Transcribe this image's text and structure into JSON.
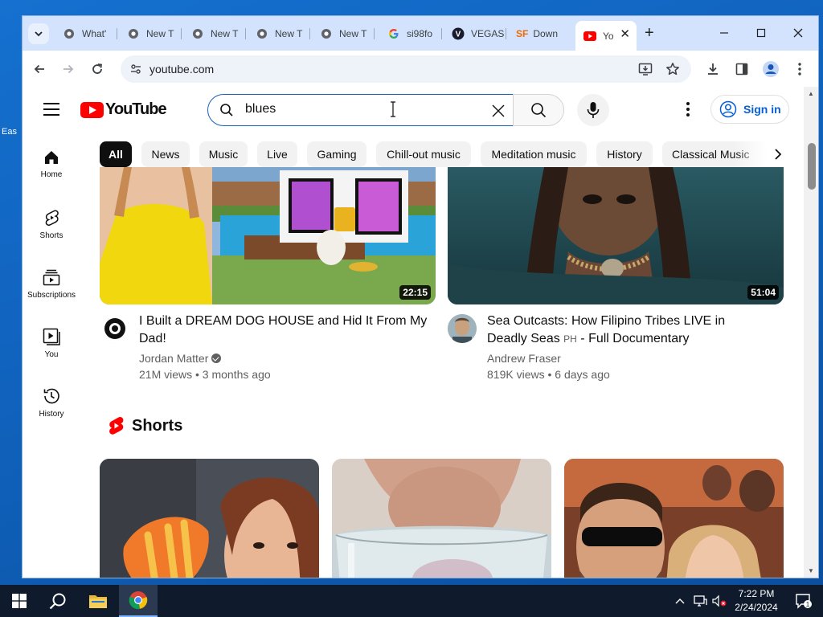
{
  "desktop": {
    "partial_label": "Eas"
  },
  "browser": {
    "tabs": [
      {
        "label": "What'",
        "icon": "chrome-icon"
      },
      {
        "label": "New T",
        "icon": "chrome-icon"
      },
      {
        "label": "New T",
        "icon": "chrome-icon"
      },
      {
        "label": "New T",
        "icon": "chrome-icon"
      },
      {
        "label": "New T",
        "icon": "chrome-icon"
      },
      {
        "label": "si98fo",
        "icon": "google-icon"
      },
      {
        "label": "VEGAS",
        "icon": "vegas-icon"
      },
      {
        "label": "Down",
        "icon": "sourceforge-icon"
      },
      {
        "label": "Yo",
        "icon": "youtube-icon",
        "active": true
      }
    ],
    "new_tab_label": "+",
    "sourceforge_mark": "SF",
    "vegas_mark": "V",
    "url": "youtube.com"
  },
  "youtube": {
    "logo_text": "YouTube",
    "search": {
      "value": "blues"
    },
    "sign_in_label": "Sign in",
    "sidebar": [
      {
        "label": "Home",
        "icon": "home-icon"
      },
      {
        "label": "Shorts",
        "icon": "shorts-icon"
      },
      {
        "label": "Subscriptions",
        "icon": "subscriptions-icon"
      },
      {
        "label": "You",
        "icon": "you-icon"
      },
      {
        "label": "History",
        "icon": "history-icon"
      }
    ],
    "chips": [
      "All",
      "News",
      "Music",
      "Live",
      "Gaming",
      "Chill-out music",
      "Meditation music",
      "History",
      "Classical Music"
    ],
    "videos": [
      {
        "title": "I Built a DREAM DOG HOUSE and Hid It From My Dad!",
        "channel": "Jordan Matter",
        "verified": true,
        "meta": "21M views • 3 months ago",
        "duration": "22:15"
      },
      {
        "title": "Sea Outcasts: How Filipino Tribes LIVE in Deadly Seas",
        "title_badge": "PH",
        "title_suffix": "- Full Documentary",
        "channel": "Andrew Fraser",
        "verified": false,
        "meta": "819K views • 6 days ago",
        "duration": "51:04"
      }
    ],
    "shorts_heading": "Shorts"
  },
  "taskbar": {
    "time": "7:22 PM",
    "date": "2/24/2024",
    "notification_count": "1"
  },
  "colors": {
    "youtube_red": "#ff0000",
    "link_blue": "#065fd4",
    "tabstrip": "#d3e3fd"
  }
}
